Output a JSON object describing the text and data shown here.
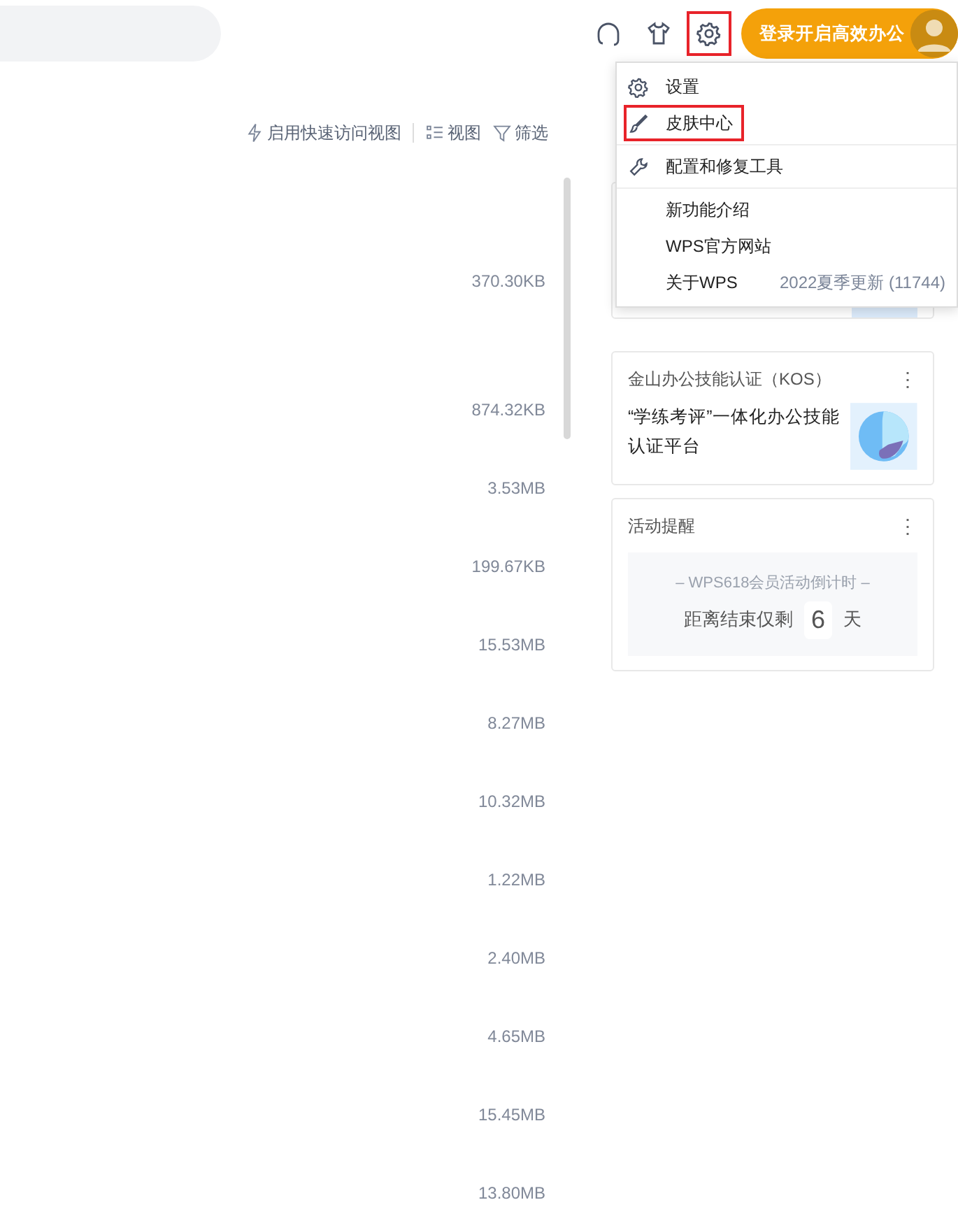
{
  "header": {
    "icons": [
      {
        "kind": "headset",
        "annotated": false
      },
      {
        "kind": "shirt",
        "annotated": false
      },
      {
        "kind": "gear",
        "annotated": true
      }
    ],
    "login_button": "登录开启高效办公"
  },
  "toolbar": [
    {
      "kind": "bolt",
      "label": "启用快速访问视图"
    },
    {
      "kind": "list",
      "label": "视图"
    },
    {
      "kind": "filter",
      "label": "筛选"
    }
  ],
  "file_sizes": [
    "370.30KB",
    "874.32KB",
    "3.53MB",
    "199.67KB",
    "15.53MB",
    "8.27MB",
    "10.32MB",
    "1.22MB",
    "2.40MB",
    "4.65MB",
    "15.45MB",
    "13.80MB"
  ],
  "cards": [
    {
      "kind": "hidden"
    },
    {
      "kind": "promo",
      "title": "金山办公技能认证（KOS）",
      "menu": "⋮",
      "text": "“学练考评”一体化办公技能认证平台"
    },
    {
      "kind": "countdown",
      "title": "活动提醒",
      "menu": "⋮",
      "subtitle": "– WPS618会员活动倒计时 –",
      "before": "距离结束仅剩",
      "days": "6",
      "after": "天"
    }
  ],
  "menu_groups": [
    [
      {
        "kind": "gear",
        "label": "设置",
        "annotated": false
      },
      {
        "kind": "brush",
        "label": "皮肤中心",
        "annotated": true
      }
    ],
    [
      {
        "kind": "wrench",
        "label": "配置和修复工具",
        "annotated": false
      }
    ],
    [
      {
        "kind": "none",
        "label": "新功能介绍",
        "annotated": false
      },
      {
        "kind": "none",
        "label": "WPS官方网站",
        "annotated": false
      },
      {
        "kind": "none",
        "label": "关于WPS",
        "note": "2022夏季更新 (11744)",
        "annotated": false
      }
    ]
  ]
}
